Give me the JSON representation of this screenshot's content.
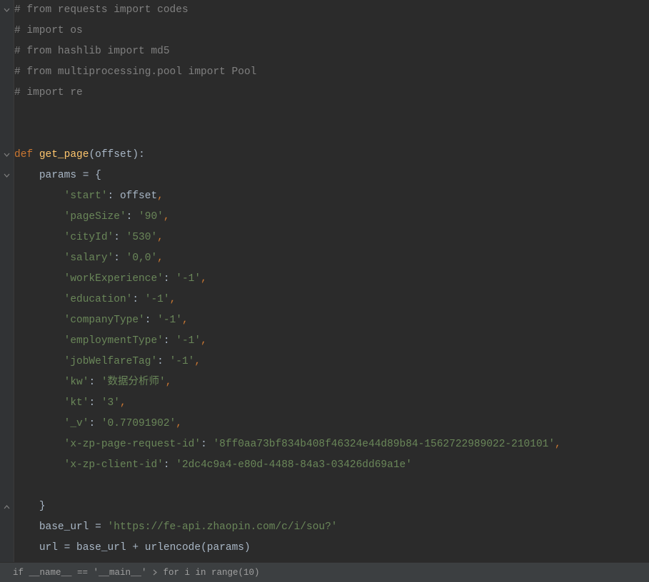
{
  "code": {
    "lines": [
      {
        "type": "comment",
        "text": "# from requests import codes"
      },
      {
        "type": "comment",
        "text": "# import os"
      },
      {
        "type": "comment",
        "text": "# from hashlib import md5"
      },
      {
        "type": "comment",
        "text": "# from multiprocessing.pool import Pool"
      },
      {
        "type": "comment",
        "text": "# import re"
      },
      {
        "type": "blank",
        "text": ""
      },
      {
        "type": "blank",
        "text": ""
      },
      {
        "type": "def",
        "kw": "def",
        "name": "get_page",
        "params": "offset"
      },
      {
        "type": "assign",
        "indent": "    ",
        "lhs": "params",
        "rhs_open": "{"
      },
      {
        "type": "dictline",
        "indent": "        ",
        "key": "'start'",
        "val_ident": "offset",
        "trail": ","
      },
      {
        "type": "dictline",
        "indent": "        ",
        "key": "'pageSize'",
        "val_str": "'90'",
        "trail": ","
      },
      {
        "type": "dictline",
        "indent": "        ",
        "key": "'cityId'",
        "val_str": "'530'",
        "trail": ","
      },
      {
        "type": "dictline",
        "indent": "        ",
        "key": "'salary'",
        "val_str": "'0,0'",
        "trail": ","
      },
      {
        "type": "dictline",
        "indent": "        ",
        "key": "'workExperience'",
        "val_str": "'-1'",
        "trail": ","
      },
      {
        "type": "dictline",
        "indent": "        ",
        "key": "'education'",
        "val_str": "'-1'",
        "trail": ","
      },
      {
        "type": "dictline",
        "indent": "        ",
        "key": "'companyType'",
        "val_str": "'-1'",
        "trail": ","
      },
      {
        "type": "dictline",
        "indent": "        ",
        "key": "'employmentType'",
        "val_str": "'-1'",
        "trail": ","
      },
      {
        "type": "dictline",
        "indent": "        ",
        "key": "'jobWelfareTag'",
        "val_str": "'-1'",
        "trail": ","
      },
      {
        "type": "dictline",
        "indent": "        ",
        "key": "'kw'",
        "val_str": "'数据分析师'",
        "trail": ","
      },
      {
        "type": "dictline",
        "indent": "        ",
        "key": "'kt'",
        "val_str": "'3'",
        "trail": ","
      },
      {
        "type": "dictline",
        "indent": "        ",
        "key": "'_v'",
        "val_str": "'0.77091902'",
        "trail": ","
      },
      {
        "type": "dictline",
        "indent": "        ",
        "key": "'x-zp-page-request-id'",
        "val_str": "'8ff0aa73bf834b408f46324e44d89b84-1562722989022-210101'",
        "trail": ","
      },
      {
        "type": "dictline",
        "indent": "        ",
        "key": "'x-zp-client-id'",
        "val_str": "'2dc4c9a4-e80d-4488-84a3-03426dd69a1e'"
      },
      {
        "type": "blank",
        "text": ""
      },
      {
        "type": "close",
        "indent": "    ",
        "brace": "}"
      },
      {
        "type": "assign2",
        "indent": "    ",
        "lhs": "base_url",
        "rhs_str": "'https://fe-api.zhaopin.com/c/i/sou?'"
      },
      {
        "type": "assign3",
        "indent": "    ",
        "lhs": "url",
        "rhs_a": "base_url",
        "op": "+",
        "rhs_b": "urlencode",
        "rhs_arg": "params"
      }
    ]
  },
  "foldMarkers": [
    {
      "line": 0,
      "kind": "down"
    },
    {
      "line": 7,
      "kind": "down"
    },
    {
      "line": 8,
      "kind": "down"
    },
    {
      "line": 24,
      "kind": "up"
    }
  ],
  "breadcrumb": {
    "items": [
      "if __name__ == '__main__'",
      "for i in range(10)"
    ]
  }
}
